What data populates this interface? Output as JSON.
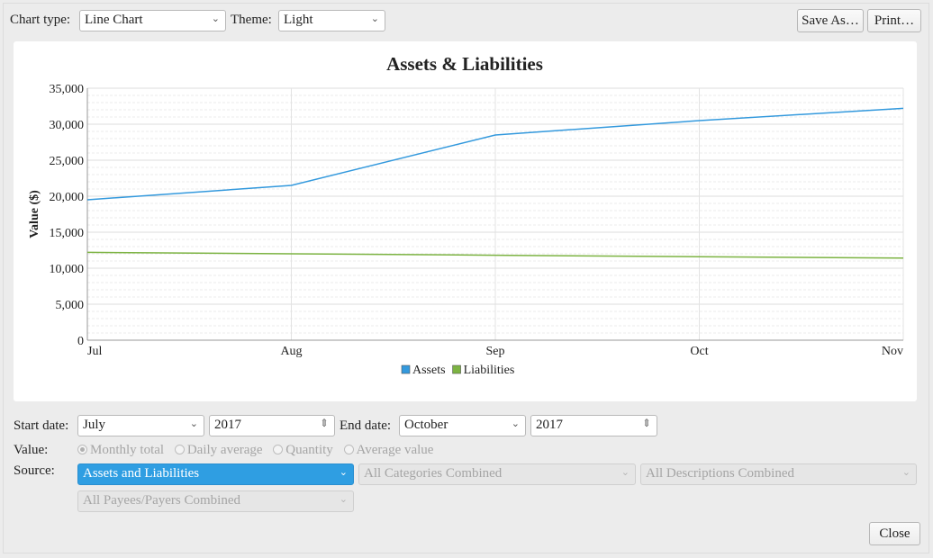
{
  "toolbar": {
    "chart_type_label": "Chart type:",
    "chart_type_value": "Line Chart",
    "theme_label": "Theme:",
    "theme_value": "Light",
    "save_as_label": "Save As…",
    "print_label": "Print…"
  },
  "chart_data": {
    "type": "line",
    "title": "Assets & Liabilities",
    "ylabel": "Value ($)",
    "xlabel": "",
    "categories": [
      "Jul",
      "Aug",
      "Sep",
      "Oct",
      "Nov"
    ],
    "ylim": [
      0,
      35000
    ],
    "yticks": [
      0,
      5000,
      10000,
      15000,
      20000,
      25000,
      30000,
      35000
    ],
    "ytick_labels": [
      "0",
      "5,000",
      "10,000",
      "15,000",
      "20,000",
      "25,000",
      "30,000",
      "35,000"
    ],
    "grid": true,
    "legend_position": "bottom-center",
    "series": [
      {
        "name": "Assets",
        "color": "#3399dd",
        "values": [
          19500,
          21500,
          28500,
          30500,
          32200
        ]
      },
      {
        "name": "Liabilities",
        "color": "#7cb342",
        "values": [
          12200,
          12000,
          11800,
          11600,
          11400
        ]
      }
    ]
  },
  "filters": {
    "start_date_label": "Start date:",
    "start_month": "July",
    "start_year": "2017",
    "end_date_label": "End date:",
    "end_month": "October",
    "end_year": "2017",
    "value_label": "Value:",
    "value_options": [
      "Monthly total",
      "Daily average",
      "Quantity",
      "Average value"
    ],
    "value_selected": "Monthly total",
    "source_label": "Source:",
    "source_value": "Assets and Liabilities",
    "categories_value": "All Categories Combined",
    "descriptions_value": "All Descriptions Combined",
    "payees_value": "All Payees/Payers Combined"
  },
  "footer": {
    "close_label": "Close"
  }
}
